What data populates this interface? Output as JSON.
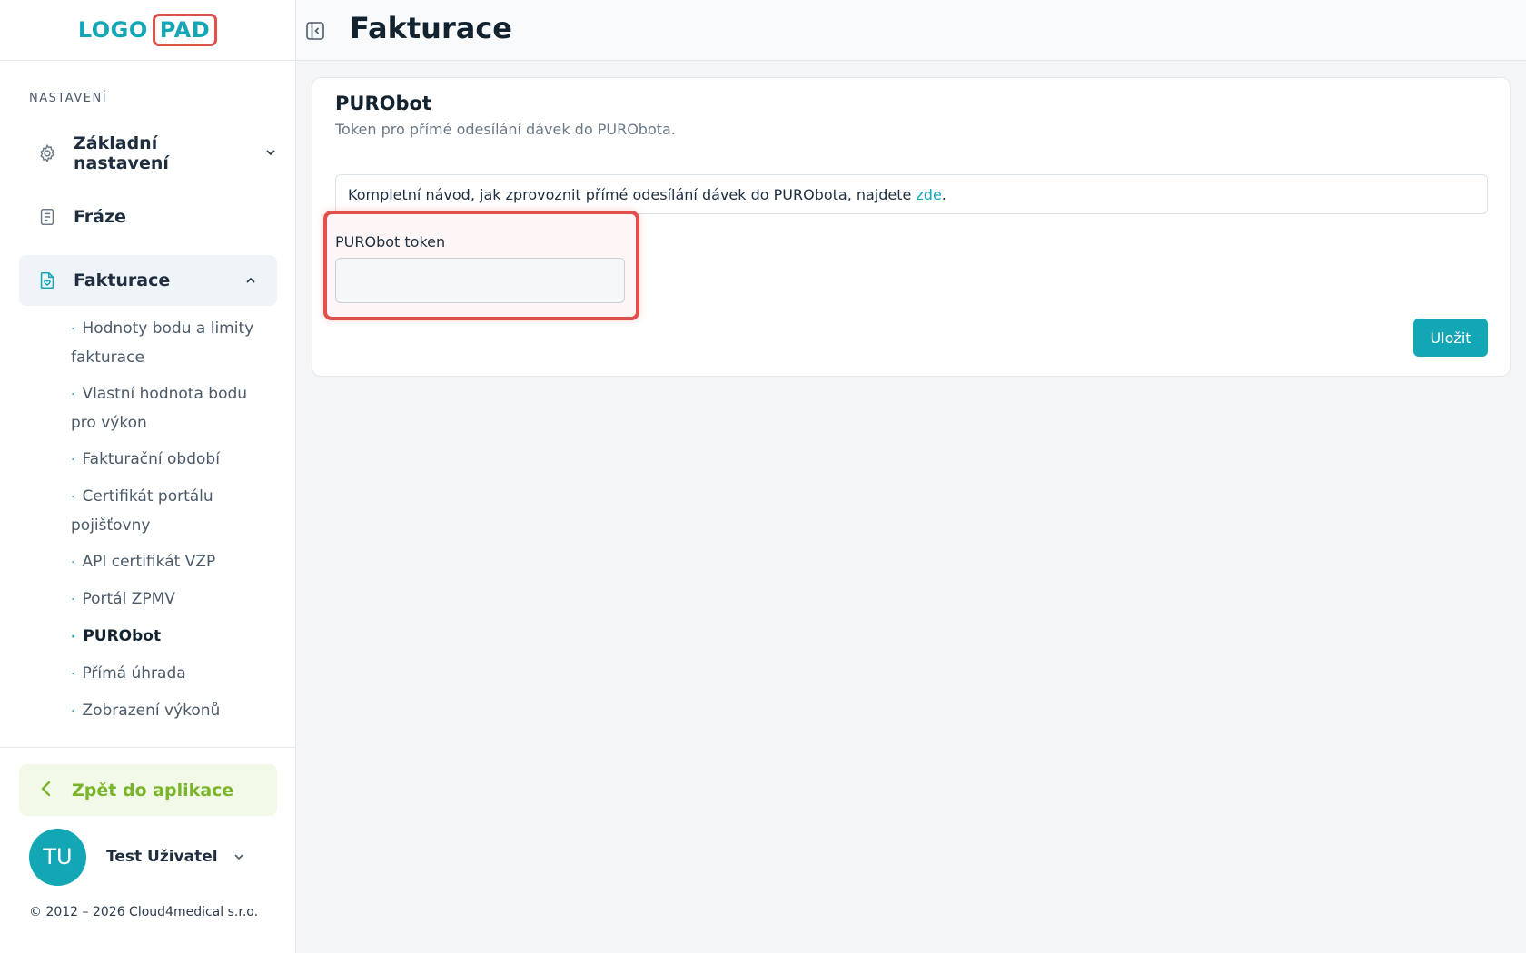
{
  "logo": {
    "part1": "LOGO",
    "part2": "PAD"
  },
  "sidebar": {
    "section_label": "NASTAVENÍ",
    "items": [
      {
        "label": "Základní nastavení",
        "icon": "gear-icon",
        "expanded": false
      },
      {
        "label": "Fráze",
        "icon": "document-icon"
      },
      {
        "label": "Fakturace",
        "icon": "invoice-icon",
        "expanded": true,
        "active": true
      }
    ],
    "sub_items": [
      "Hodnoty bodu a limity fakturace",
      "Vlastní hodnota bodu pro výkon",
      "Fakturační období",
      "Certifikát portálu pojišťovny",
      "API certifikát VZP",
      "Portál ZPMV",
      "PURObot",
      "Přímá úhrada",
      "Zobrazení výkonů"
    ],
    "current_sub_item": "PURObot",
    "back_label": "Zpět do aplikace",
    "user": {
      "initials": "TU",
      "name": "Test Uživatel"
    },
    "copyright": "© 2012 – 2026 Cloud4medical s.r.o."
  },
  "header": {
    "title": "Fakturace"
  },
  "card": {
    "title": "PURObot",
    "description": "Token pro přímé odesílání dávek do PURObota.",
    "info_text": "Kompletní návod, jak zprovoznit přímé odesílání dávek do PURObota, najdete",
    "info_link": "zde",
    "info_suffix": ".",
    "field_label": "PURObot token",
    "field_value": "",
    "save_label": "Uložit"
  },
  "colors": {
    "accent": "#13a7b6",
    "back_green": "#79b52a",
    "highlight_red": "#e2504a"
  }
}
